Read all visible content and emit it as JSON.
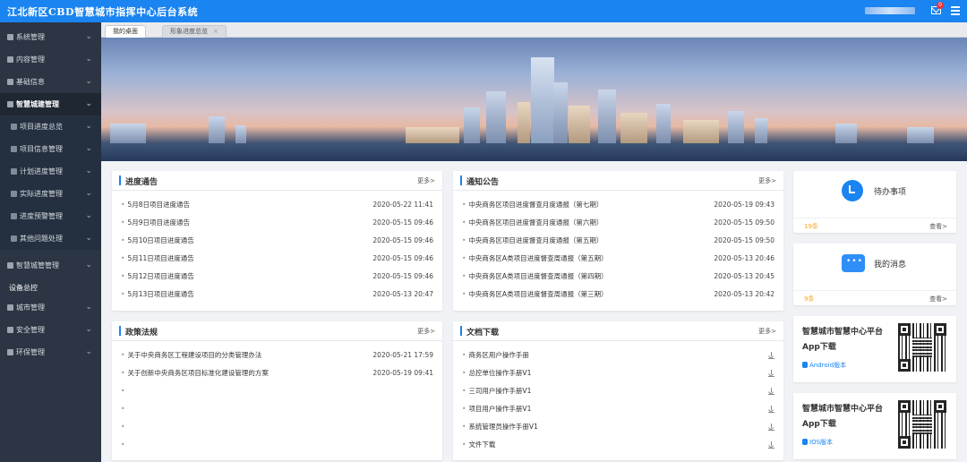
{
  "header": {
    "title": "江北新区CBD智慧城市指挥中心后台系统",
    "mail_badge": "0"
  },
  "sidebar": {
    "items": [
      {
        "label": "系统管理"
      },
      {
        "label": "内容管理"
      },
      {
        "label": "基础信息"
      },
      {
        "label": "智慧城建管理"
      },
      {
        "label": "项目进度总览"
      },
      {
        "label": "项目信息管理"
      },
      {
        "label": "计划进度管理"
      },
      {
        "label": "实际进度管理"
      },
      {
        "label": "进度预警管理"
      },
      {
        "label": "其他问题处理"
      },
      {
        "label": "智慧城管管理"
      }
    ],
    "group_label": "设备总控",
    "group_items": [
      {
        "label": "城市管理"
      },
      {
        "label": "安全管理"
      },
      {
        "label": "环保管理"
      }
    ]
  },
  "tabs": [
    {
      "label": "我的桌面"
    },
    {
      "label": "形象进度总览"
    }
  ],
  "tab_close": "×",
  "cards": {
    "progress": {
      "title": "进度通告",
      "more": "更多>",
      "rows": [
        {
          "text": "5月8日项目进度通告",
          "date": "2020-05-22 11:41"
        },
        {
          "text": "5月9日项目进度通告",
          "date": "2020-05-15 09:46"
        },
        {
          "text": "5月10日项目进度通告",
          "date": "2020-05-15 09:46"
        },
        {
          "text": "5月11日项目进度通告",
          "date": "2020-05-15 09:46"
        },
        {
          "text": "5月12日项目进度通告",
          "date": "2020-05-15 09:46"
        },
        {
          "text": "5月13日项目进度通告",
          "date": "2020-05-13 20:47"
        }
      ]
    },
    "notice": {
      "title": "通知公告",
      "more": "更多>",
      "rows": [
        {
          "text": "中央商务区项目进度督查月度通报（第七期）",
          "date": "2020-05-19 09:43"
        },
        {
          "text": "中央商务区项目进度督查月度通报（第六期）",
          "date": "2020-05-15 09:50"
        },
        {
          "text": "中央商务区项目进度督查月度通报（第五期）",
          "date": "2020-05-15 09:50"
        },
        {
          "text": "中央商务区A类项目进度督查周通报（第五期）",
          "date": "2020-05-13 20:46"
        },
        {
          "text": "中央商务区A类项目进度督查周通报（第四期）",
          "date": "2020-05-13 20:45"
        },
        {
          "text": "中央商务区A类项目进度督查周通报（第三期）",
          "date": "2020-05-13 20:42"
        }
      ]
    },
    "policy": {
      "title": "政策法规",
      "more": "更多>",
      "rows": [
        {
          "text": "关于中央商务区工程建设项目的分类管理办法",
          "date": "2020-05-21 17:59"
        },
        {
          "text": "关于创新中央商务区项目标准化建设管理的方案",
          "date": "2020-05-19 09:41"
        },
        {
          "text": "",
          "date": ""
        },
        {
          "text": "",
          "date": ""
        },
        {
          "text": "",
          "date": ""
        },
        {
          "text": "",
          "date": ""
        }
      ]
    },
    "docs": {
      "title": "文档下载",
      "more": "更多>",
      "rows": [
        {
          "text": "商务区用户操作手册"
        },
        {
          "text": "总控单位操作手册V1"
        },
        {
          "text": "三司用户操作手册V1"
        },
        {
          "text": "项目用户操作手册V1"
        },
        {
          "text": "系统管理员操作手册V1"
        },
        {
          "text": "文件下载"
        }
      ]
    }
  },
  "widgets": {
    "todo": {
      "label": "待办事项",
      "count": "19条",
      "view": "查看>"
    },
    "messages": {
      "label": "我的消息",
      "count": "9条",
      "view": "查看>"
    },
    "android": {
      "title": "智慧城市智慧中心平台App下载",
      "link": "Android版本"
    },
    "ios": {
      "title": "智慧城市智慧中心平台App下载",
      "link": "IOS版本"
    }
  },
  "colors": {
    "header": "#1a84f0",
    "sidebar": "#2b3543",
    "accent": "#1a84f0",
    "count": "#f5a623"
  }
}
